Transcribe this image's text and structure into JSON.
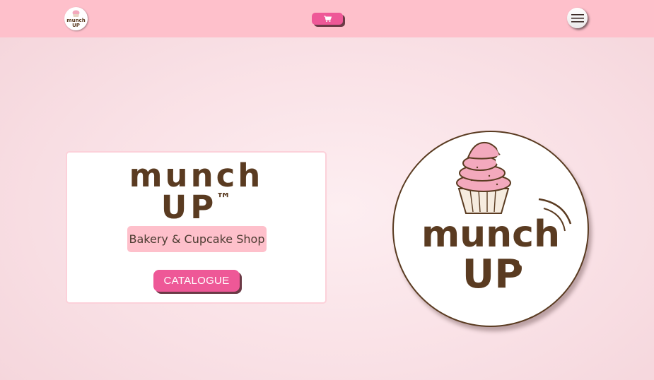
{
  "header": {
    "logo_icon": "munch-up-mini-logo",
    "logo_text_line1": "munch",
    "logo_text_line2": "UP",
    "cart_icon": "cart-icon",
    "menu_icon": "hamburger-menu-icon"
  },
  "hero": {
    "brand_line1": "munch",
    "brand_line2": "UP",
    "trademark": "™",
    "tagline": "Bakery & Cupcake Shop",
    "catalogue_label": "CATALOGUE"
  },
  "big_logo": {
    "text_line1": "munch",
    "text_line2": "UP",
    "icon": "cupcake-icon"
  },
  "colors": {
    "topbar": "#fec0cb",
    "accent": "#ee5897",
    "brand_brown": "#5a3b21",
    "frosting_pink": "#f3a9bd"
  }
}
